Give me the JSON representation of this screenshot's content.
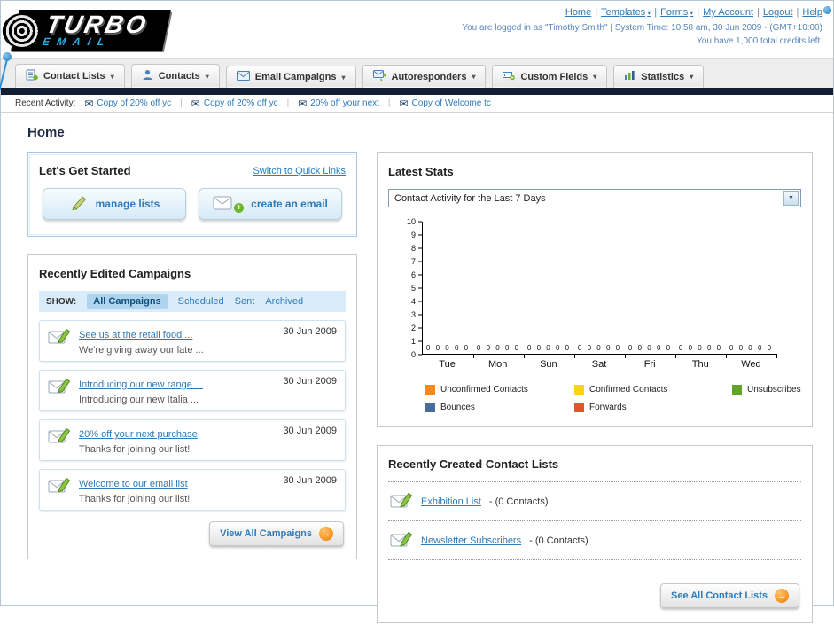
{
  "header": {
    "logo_title": "TURBO",
    "logo_sub": "EMAIL",
    "links": [
      {
        "label": "Home",
        "caret": false
      },
      {
        "label": "Templates",
        "caret": true
      },
      {
        "label": "Forms",
        "caret": true
      },
      {
        "label": "My Account",
        "caret": false
      },
      {
        "label": "Logout",
        "caret": false
      },
      {
        "label": "Help",
        "caret": false
      }
    ],
    "login_info": "You are logged in as \"Timothy Smith\" | System Time: 10:58 am, 30 Jun 2009 - (GMT+10:00)",
    "credits_info": "You have 1,000 total credits left."
  },
  "nav_tabs": [
    {
      "label": "Contact Lists",
      "icon": "contact-lists-icon"
    },
    {
      "label": "Contacts",
      "icon": "contacts-icon"
    },
    {
      "label": "Email Campaigns",
      "icon": "email-campaigns-icon"
    },
    {
      "label": "Autoresponders",
      "icon": "autoresponders-icon"
    },
    {
      "label": "Custom Fields",
      "icon": "custom-fields-icon"
    },
    {
      "label": "Statistics",
      "icon": "statistics-icon"
    }
  ],
  "recent_activity": {
    "label": "Recent Activity:",
    "items": [
      "Copy of 20% off yc",
      "Copy of 20% off yc",
      "20% off your next",
      "Copy of Welcome tc"
    ]
  },
  "page_title": "Home",
  "get_started": {
    "title": "Let's Get Started",
    "switch_link": "Switch to Quick Links",
    "manage_lists_label": "manage lists",
    "create_email_label": "create an email"
  },
  "campaigns": {
    "title": "Recently Edited Campaigns",
    "show_label": "SHOW:",
    "tabs": [
      "All Campaigns",
      "Scheduled",
      "Sent",
      "Archived"
    ],
    "active_tab": "All Campaigns",
    "items": [
      {
        "title": "See us at the retail food ...",
        "subtitle": "We're giving away our late ...",
        "date": "30 Jun 2009"
      },
      {
        "title": "Introducing our new range ...",
        "subtitle": "Introducing our new Italia ...",
        "date": "30 Jun 2009"
      },
      {
        "title": "20% off your next purchase",
        "subtitle": "Thanks for joining our list!",
        "date": "30 Jun 2009"
      },
      {
        "title": "Welcome to our email list",
        "subtitle": "Thanks for joining our list!",
        "date": "30 Jun 2009"
      }
    ],
    "view_all_label": "View All Campaigns"
  },
  "stats": {
    "title": "Latest Stats",
    "dropdown_value": "Contact Activity for the Last 7 Days",
    "legend": [
      {
        "label": "Unconfirmed Contacts",
        "color": "#f6891f"
      },
      {
        "label": "Confirmed Contacts",
        "color": "#ffd21e"
      },
      {
        "label": "Unsubscribes",
        "color": "#62a427"
      },
      {
        "label": "Bounces",
        "color": "#4a6c9b"
      },
      {
        "label": "Forwards",
        "color": "#e3542c"
      }
    ]
  },
  "chart_data": {
    "type": "bar",
    "title": "Contact Activity for the Last 7 Days",
    "categories": [
      "Tue",
      "Mon",
      "Sun",
      "Sat",
      "Fri",
      "Thu",
      "Wed"
    ],
    "series": [
      {
        "name": "Unconfirmed Contacts",
        "color": "#f6891f",
        "values": [
          0,
          0,
          0,
          0,
          0,
          0,
          0
        ]
      },
      {
        "name": "Confirmed Contacts",
        "color": "#ffd21e",
        "values": [
          0,
          0,
          0,
          0,
          0,
          0,
          0
        ]
      },
      {
        "name": "Unsubscribes",
        "color": "#62a427",
        "values": [
          0,
          0,
          0,
          0,
          0,
          0,
          0
        ]
      },
      {
        "name": "Bounces",
        "color": "#4a6c9b",
        "values": [
          0,
          0,
          0,
          0,
          0,
          0,
          0
        ]
      },
      {
        "name": "Forwards",
        "color": "#e3542c",
        "values": [
          0,
          0,
          0,
          0,
          0,
          0,
          0
        ]
      }
    ],
    "xlabel": "",
    "ylabel": "",
    "ylim": [
      0,
      10
    ],
    "yticks": [
      0,
      1,
      2,
      3,
      4,
      5,
      6,
      7,
      8,
      9,
      10
    ],
    "grid": false,
    "legend_position": "bottom"
  },
  "contact_lists": {
    "title": "Recently Created Contact Lists",
    "items": [
      {
        "name": "Exhibition List",
        "suffix": "- (0 Contacts)"
      },
      {
        "name": "Newsletter Subscribers",
        "suffix": "- (0 Contacts)"
      }
    ],
    "see_all_label": "See All Contact Lists"
  }
}
